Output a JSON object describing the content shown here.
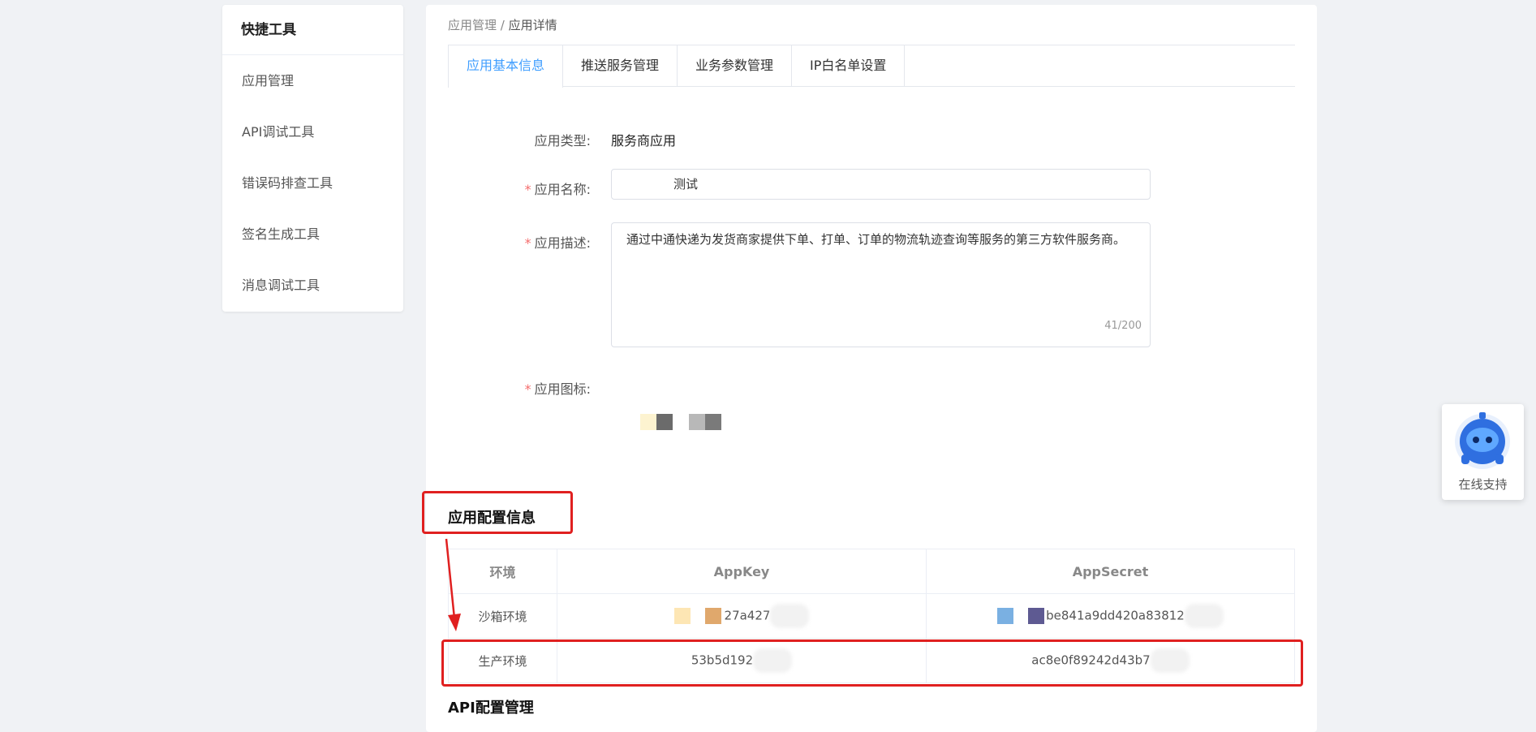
{
  "sidebar": {
    "title": "快捷工具",
    "items": [
      {
        "label": "应用管理"
      },
      {
        "label": "API调试工具"
      },
      {
        "label": "错误码排查工具"
      },
      {
        "label": "签名生成工具"
      },
      {
        "label": "消息调试工具"
      }
    ]
  },
  "breadcrumb": {
    "parent": "应用管理",
    "separator": " / ",
    "current": "应用详情"
  },
  "tabs": [
    {
      "label": "应用基本信息",
      "active": true
    },
    {
      "label": "推送服务管理"
    },
    {
      "label": "业务参数管理"
    },
    {
      "label": "IP白名单设置"
    }
  ],
  "form": {
    "type_label": "应用类型:",
    "type_value": "服务商应用",
    "name_label": "应用名称:",
    "name_value": "测试",
    "desc_label": "应用描述:",
    "desc_value": "通过中通快递为发货商家提供下单、打单、订单的物流轨迹查询等服务的第三方软件服务商。",
    "desc_counter": "41/200",
    "icon_label": "应用图标:",
    "required_mark": "*"
  },
  "config": {
    "title": "应用配置信息",
    "headers": {
      "env": "环境",
      "appkey": "AppKey",
      "appsecret": "AppSecret"
    },
    "rows": [
      {
        "env": "沙箱环境",
        "appkey": "27a427",
        "appsecret": "be841a9dd420a83812"
      },
      {
        "env": "生产环境",
        "appkey": "53b5d192",
        "appsecret": "ac8e0f89242d43b7"
      }
    ]
  },
  "api_section": {
    "title": "API配置管理"
  },
  "support": {
    "label": "在线支持"
  },
  "colors": {
    "accent": "#409eff",
    "highlight": "#e02020",
    "required": "#f56c6c"
  }
}
